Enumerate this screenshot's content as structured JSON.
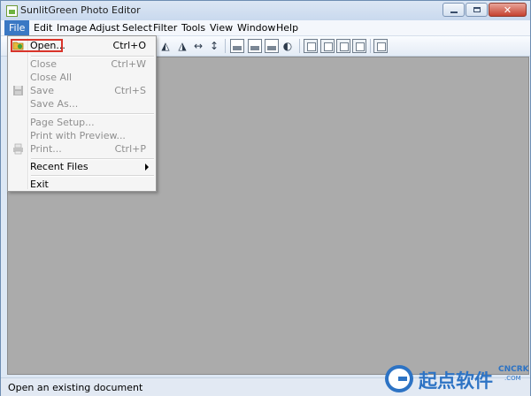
{
  "window": {
    "title": "SunlitGreen Photo Editor",
    "icon": "app-logo-icon",
    "controls": {
      "minimize": "minimize-icon",
      "maximize": "maximize-icon",
      "close": "close-icon",
      "close_glyph": "✕"
    }
  },
  "menubar": {
    "items": [
      "File",
      "Edit",
      "Image",
      "Adjust",
      "Select",
      "Filter",
      "Tools",
      "View",
      "Window",
      "Help"
    ],
    "active": "File"
  },
  "toolbar": {
    "icons": [
      "flip-horizontal-icon",
      "flip-vertical-icon",
      "resize-width-icon",
      "resize-height-icon",
      "histogram-icon",
      "curves-icon",
      "levels-icon",
      "brightness-icon",
      "frame-icon",
      "border-icon",
      "canvas-icon",
      "crop-frame-icon",
      "fullscreen-icon"
    ],
    "glyphs": {
      "flip_h": "◭",
      "flip_v": "◮",
      "resize_w": "↔",
      "resize_h": "↕",
      "brightness": "◐"
    }
  },
  "file_menu": {
    "items": [
      {
        "label": "Open...",
        "shortcut": "Ctrl+O",
        "enabled": true,
        "icon": "open-folder-icon"
      },
      {
        "label": "Close",
        "shortcut": "Ctrl+W",
        "enabled": false
      },
      {
        "label": "Close All",
        "shortcut": "",
        "enabled": false
      },
      {
        "label": "Save",
        "shortcut": "Ctrl+S",
        "enabled": false,
        "icon": "save-icon"
      },
      {
        "label": "Save As...",
        "shortcut": "",
        "enabled": false
      },
      {
        "label": "Page Setup...",
        "shortcut": "",
        "enabled": false
      },
      {
        "label": "Print with Preview...",
        "shortcut": "",
        "enabled": false
      },
      {
        "label": "Print...",
        "shortcut": "Ctrl+P",
        "enabled": false,
        "icon": "printer-icon"
      },
      {
        "label": "Recent Files",
        "shortcut": "",
        "enabled": true,
        "submenu": true
      },
      {
        "label": "Exit",
        "shortcut": "",
        "enabled": true
      }
    ]
  },
  "statusbar": {
    "text": "Open an existing document"
  },
  "watermark": {
    "text": "起点软件",
    "tag": "CNCRK",
    "tag2": ".COM"
  },
  "colors": {
    "accent": "#3a78c4",
    "highlight_box": "#d9342a",
    "workspace": "#ababab"
  }
}
